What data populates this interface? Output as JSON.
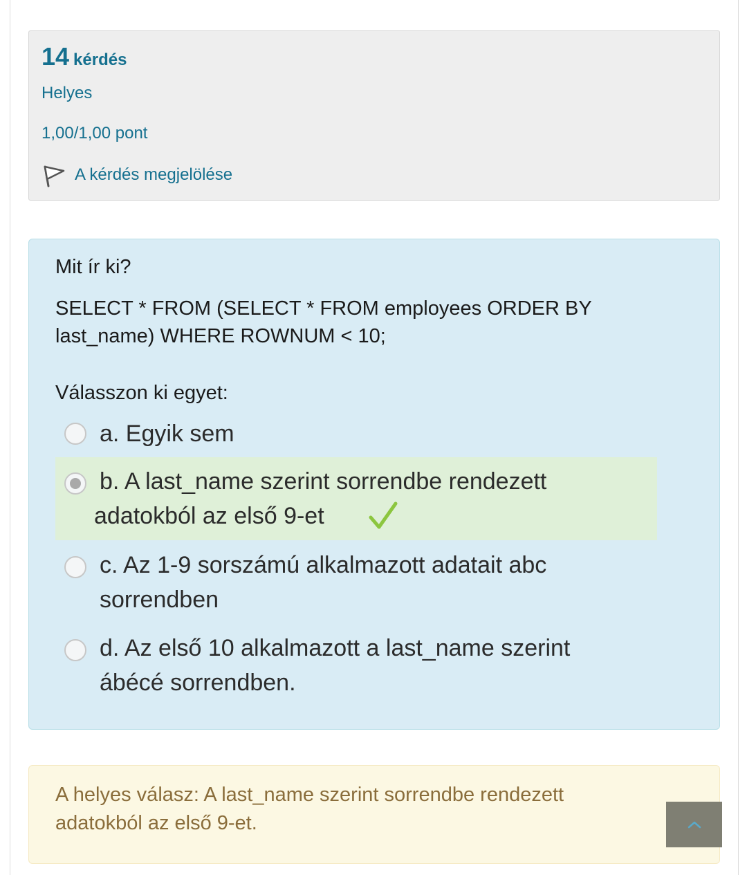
{
  "info": {
    "number": "14",
    "number_word": "kérdés",
    "state": "Helyes",
    "grade": "1,00/1,00 pont",
    "flag_label": "A kérdés megjelölése"
  },
  "question": {
    "prompt": "Mit ír ki?",
    "sql": "SELECT * FROM (SELECT * FROM employees ORDER BY last_name) WHERE ROWNUM < 10;",
    "choose_label": "Válasszon ki egyet:",
    "options": [
      {
        "label": "a. Egyik sem",
        "selected": false,
        "correct": false
      },
      {
        "label": "b. A last_name szerint sorrendbe rendezett adatokból az első 9-et",
        "selected": true,
        "correct": true
      },
      {
        "label": "c. Az 1-9 sorszámú alkalmazott adatait abc sorrendben",
        "selected": false,
        "correct": false
      },
      {
        "label": "d. Az első 10 alkalmazott a last_name szerint ábécé sorrendben.",
        "selected": false,
        "correct": false
      }
    ]
  },
  "feedback": {
    "text": "A helyes válasz: A last_name szerint sorrendbe rendezett adatokból az első 9-et."
  },
  "colors": {
    "link_blue": "#15708f",
    "correct_green": "#8cc63f",
    "question_bg": "#d9ecf5",
    "feedback_bg": "#fcf8e3",
    "feedback_text": "#8a6d3b",
    "back_to_top_bg": "#7f7f73"
  },
  "icons": {
    "flag": "flag-icon",
    "check": "check-icon",
    "back_to_top": "chevron-up-icon"
  }
}
